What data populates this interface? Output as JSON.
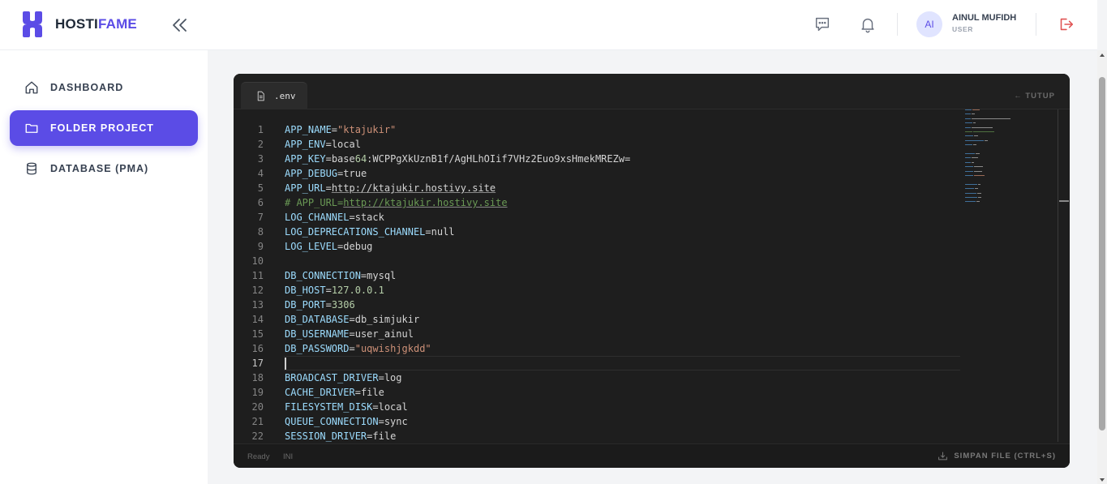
{
  "header": {
    "brand_prefix": "HOSTI",
    "brand_accent": "FAME",
    "user_initials": "AI",
    "user_name": "AINUL MUFIDH",
    "user_role": "USER"
  },
  "sidebar": {
    "items": [
      {
        "label": "DASHBOARD",
        "icon": "home-icon",
        "active": false
      },
      {
        "label": "FOLDER PROJECT",
        "icon": "folder-icon",
        "active": true
      },
      {
        "label": "DATABASE (PMA)",
        "icon": "database-icon",
        "active": false
      }
    ]
  },
  "editor": {
    "tab_label": ".env",
    "close_label": "← TUTUP",
    "status_ready": "Ready",
    "status_lang": "INI",
    "save_label": "SIMPAN FILE (CTRL+S)",
    "current_line": 17,
    "lines": [
      "APP_NAME=\"ktajukir\"",
      "APP_ENV=local",
      "APP_KEY=base64:WCPPgXkUznB1f/AgHLhOIif7VHz2Euo9xsHmekMREZw=",
      "APP_DEBUG=true",
      "APP_URL=http://ktajukir.hostivy.site",
      "# APP_URL=http://ktajukir.hostivy.site",
      "LOG_CHANNEL=stack",
      "LOG_DEPRECATIONS_CHANNEL=null",
      "LOG_LEVEL=debug",
      "",
      "DB_CONNECTION=mysql",
      "DB_HOST=127.0.0.1",
      "DB_PORT=3306",
      "DB_DATABASE=db_simjukir",
      "DB_USERNAME=user_ainul",
      "DB_PASSWORD=\"uqwishjgkdd\"",
      "",
      "BROADCAST_DRIVER=log",
      "CACHE_DRIVER=file",
      "FILESYSTEM_DISK=local",
      "QUEUE_CONNECTION=sync",
      "SESSION_DRIVER=file"
    ]
  },
  "colors": {
    "accent": "#5b4ce6",
    "editor_bg": "#1e1e1e",
    "logout": "#e05252"
  }
}
